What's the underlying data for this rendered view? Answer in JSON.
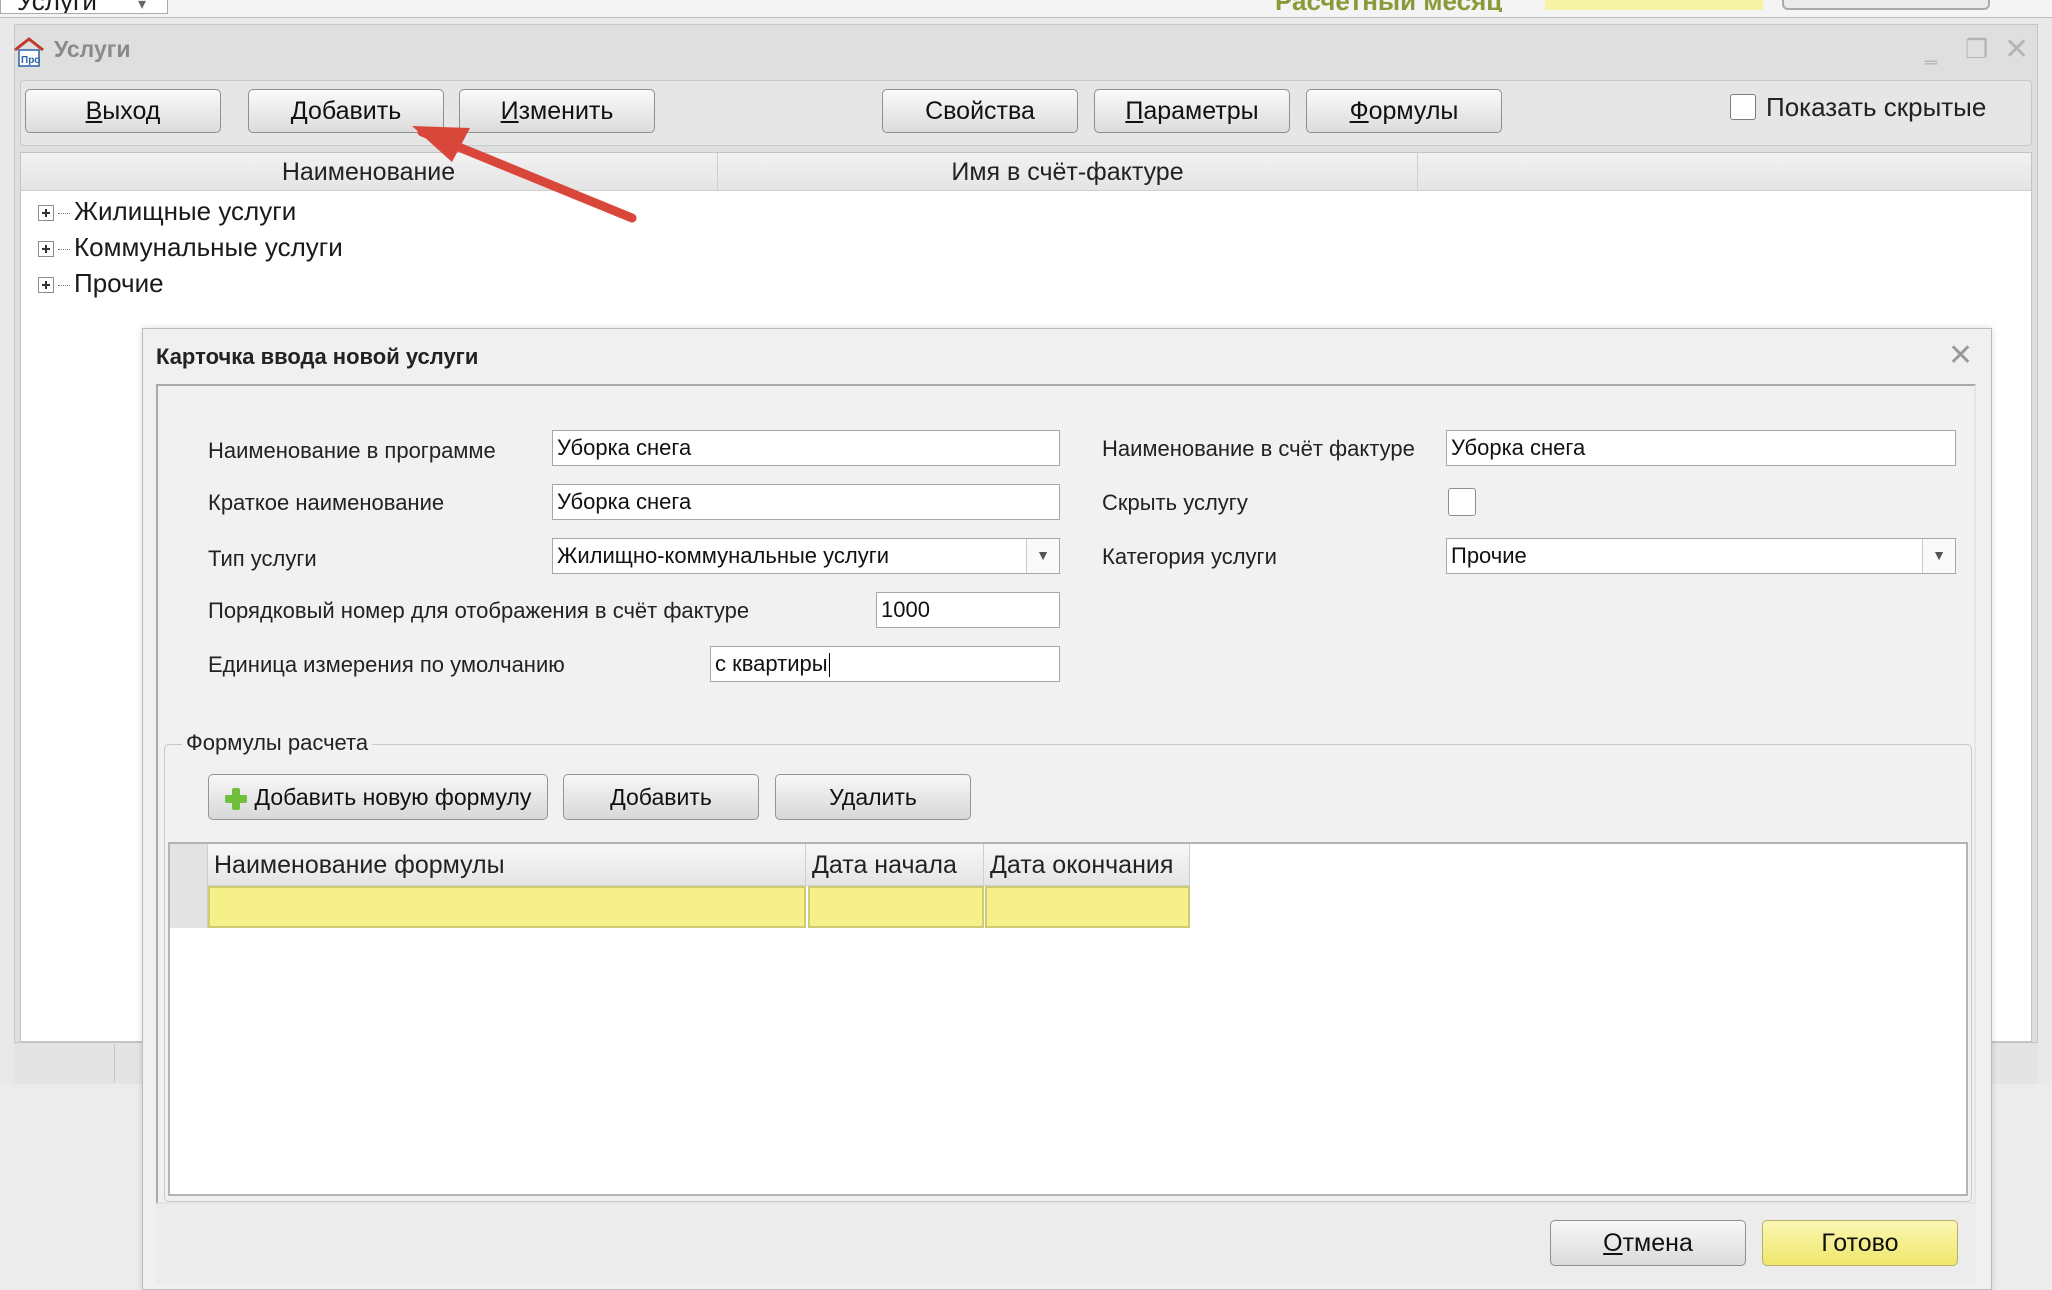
{
  "top_strip": {
    "combo_value": "Услуги",
    "status_text": "Расчетный месяц"
  },
  "window": {
    "title": "Услуги"
  },
  "toolbar": {
    "exit": {
      "mnemonic": "В",
      "rest": "ыход"
    },
    "add": {
      "mnemonic": "Д",
      "rest": "обавить"
    },
    "edit": {
      "mnemonic": "И",
      "rest": "зменить"
    },
    "properties": "Свойства",
    "parameters": {
      "mnemonic": "П",
      "rest": "араметры"
    },
    "formulas": {
      "mnemonic": "Ф",
      "rest": "ормулы"
    },
    "show_hidden": "Показать скрытые"
  },
  "tree": {
    "columns": [
      "Наименование",
      "Имя в счёт-фактуре"
    ],
    "rows": [
      "Жилищные услуги",
      "Коммунальные услуги",
      "Прочие"
    ]
  },
  "dialog": {
    "title": "Карточка ввода новой услуги",
    "fields": {
      "name_program_label": "Наименование в программе",
      "name_program_value": "Уборка снега",
      "short_name_label": "Краткое наименование",
      "short_name_value": "Уборка снега",
      "service_type_label": "Тип услуги",
      "service_type_value": "Жилищно-коммунальные услуги",
      "order_label": "Порядковый номер для отображения в счёт фактуре",
      "order_value": "1000",
      "unit_label": "Единица измерения по умолчанию",
      "unit_value": "с квартиры",
      "invoice_name_label": "Наименование в счёт фактуре",
      "invoice_name_value": "Уборка снега",
      "hide_label": "Скрыть услугу",
      "hide_checked": false,
      "category_label": "Категория услуги",
      "category_value": "Прочие"
    },
    "formulas": {
      "legend": "Формулы расчета",
      "add_new_button": "Добавить новую формулу",
      "add_button": "Добавить",
      "delete_button": "Удалить",
      "columns": [
        "Наименование формулы",
        "Дата начала",
        "Дата окончания"
      ]
    },
    "footer": {
      "cancel": {
        "mnemonic": "О",
        "rest": "тмена"
      },
      "done": "Готово"
    }
  },
  "colors": {
    "highlight_yellow": "#f5f08a",
    "arrow_red": "#d9463a",
    "accent_green": "#6fbf3a"
  }
}
